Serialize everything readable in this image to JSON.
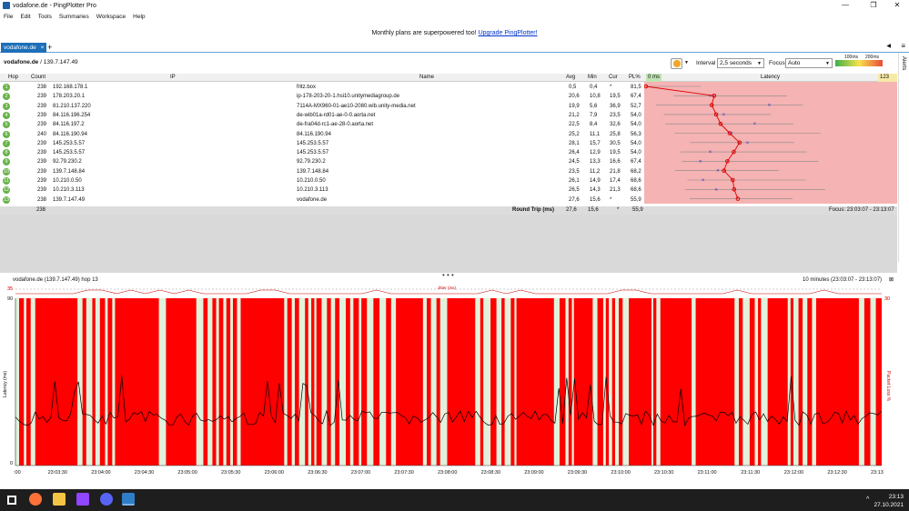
{
  "window": {
    "title": "vodafone.de - PingPlotter Pro",
    "minimize": "—",
    "maximize": "❐",
    "close": "✕"
  },
  "menu": [
    "File",
    "Edit",
    "Tools",
    "Summaries",
    "Workspace",
    "Help"
  ],
  "banner": {
    "text": "Monthly plans are superpowered too! ",
    "link": "Upgrade PingPlotter!"
  },
  "tab": {
    "label": "vodafone.de",
    "close": "×",
    "add": "+"
  },
  "target": {
    "name": "vodafone.de",
    "ip": "/ 139.7.147.49"
  },
  "controls": {
    "interval_label": "Interval",
    "interval_value": "2,5 seconds",
    "focus_label": "Focus",
    "focus_value": "Auto",
    "scale_low": "100ms",
    "scale_high": "200ms",
    "alerts": "Alerts"
  },
  "table": {
    "headers": {
      "hop": "Hop",
      "count": "Count",
      "ip": "IP",
      "name": "Name",
      "avg": "Avg",
      "min": "Min",
      "cur": "Cur",
      "pl": "PL%",
      "latency": "Latency",
      "lat_min": "0 ms",
      "lat_max": "123 ms"
    },
    "rows": [
      {
        "hop": "1",
        "count": "238",
        "ip": "192.168.178.1",
        "name": "fritz.box",
        "avg": "0,5",
        "min": "0,4",
        "cur": "*",
        "pl": "81,5"
      },
      {
        "hop": "2",
        "count": "239",
        "ip": "178.203.20.1",
        "name": "ip-178-203-20-1.hsi10.unitymediagroup.de",
        "avg": "20,6",
        "min": "10,8",
        "cur": "19,5",
        "pl": "67,4"
      },
      {
        "hop": "3",
        "count": "239",
        "ip": "81.210.137.220",
        "name": "7114A-MX960-01-ae10-2080.wib.unity-media.net",
        "avg": "19,9",
        "min": "5,6",
        "cur": "36,9",
        "pl": "52,7"
      },
      {
        "hop": "4",
        "count": "239",
        "ip": "84.116.196.254",
        "name": "de-wib01a-rd01-ae-0-0.aorta.net",
        "avg": "21,2",
        "min": "7,9",
        "cur": "23,5",
        "pl": "54,0"
      },
      {
        "hop": "5",
        "count": "239",
        "ip": "84.116.197.2",
        "name": "de-fra04d-rc1-ae-28-0.aorta.net",
        "avg": "22,5",
        "min": "8,4",
        "cur": "32,6",
        "pl": "54,0"
      },
      {
        "hop": "6",
        "count": "240",
        "ip": "84.116.190.94",
        "name": "84.116.190.94",
        "avg": "25,2",
        "min": "11,1",
        "cur": "25,8",
        "pl": "56,3"
      },
      {
        "hop": "7",
        "count": "239",
        "ip": "145.253.5.57",
        "name": "145.253.5.57",
        "avg": "28,1",
        "min": "15,7",
        "cur": "30,5",
        "pl": "54,0"
      },
      {
        "hop": "8",
        "count": "239",
        "ip": "145.253.5.57",
        "name": "145.253.5.57",
        "avg": "26,4",
        "min": "12,9",
        "cur": "19,5",
        "pl": "54,0"
      },
      {
        "hop": "9",
        "count": "239",
        "ip": "92.79.230.2",
        "name": "92.79.230.2",
        "avg": "24,5",
        "min": "13,3",
        "cur": "16,6",
        "pl": "67,4"
      },
      {
        "hop": "10",
        "count": "239",
        "ip": "139.7.148.84",
        "name": "139.7.148.84",
        "avg": "23,5",
        "min": "11,2",
        "cur": "21,8",
        "pl": "68,2"
      },
      {
        "hop": "11",
        "count": "239",
        "ip": "10.210.0.50",
        "name": "10.210.0.50",
        "avg": "26,1",
        "min": "14,9",
        "cur": "17,4",
        "pl": "68,6"
      },
      {
        "hop": "12",
        "count": "239",
        "ip": "10.210.3.113",
        "name": "10.210.3.113",
        "avg": "26,5",
        "min": "14,3",
        "cur": "21,3",
        "pl": "68,6"
      },
      {
        "hop": "13",
        "count": "238",
        "ip": "139.7.147.49",
        "name": "vodafone.de",
        "avg": "27,6",
        "min": "15,6",
        "cur": "*",
        "pl": "55,9"
      }
    ],
    "total": {
      "count": "238",
      "label": "Round Trip (ms)",
      "avg": "27,6",
      "min": "15,6",
      "cur": "*",
      "pl": "55,9",
      "focus": "Focus: 23:03:07 - 23:13:07"
    }
  },
  "graph": {
    "title": "vodafone.de (139.7.147.49) hop 13",
    "range": "10 minutes (23:03:07 - 23:13:07)",
    "jitter_label": "Jitter (ms)",
    "left_axis_label": "Latency (ms)",
    "right_axis_label": "Packet Loss %",
    "y_top": "90",
    "y_mid": "0",
    "jitter_top": "35",
    "right_top": "30",
    "time_ticks": [
      ":00",
      "23:03:30",
      "23:04:00",
      "23:04:30",
      "23:05:00",
      "23:05:30",
      "23:06:00",
      "23:06:30",
      "23:07:00",
      "23:07:30",
      "23:08:00",
      "23:08:30",
      "23:09:00",
      "23:09:30",
      "23:10:00",
      "23:10:30",
      "23:11:00",
      "23:11:30",
      "23:12:00",
      "23:12:30",
      "23:13"
    ]
  },
  "taskbar": {
    "time": "23:13",
    "date": "27.10.2021",
    "chevron": "^"
  },
  "colors": {
    "loss": "#ff0000",
    "ok": "#e1f2dc",
    "tab": "#1d6fb8",
    "hop_ok": "#67b34a"
  }
}
